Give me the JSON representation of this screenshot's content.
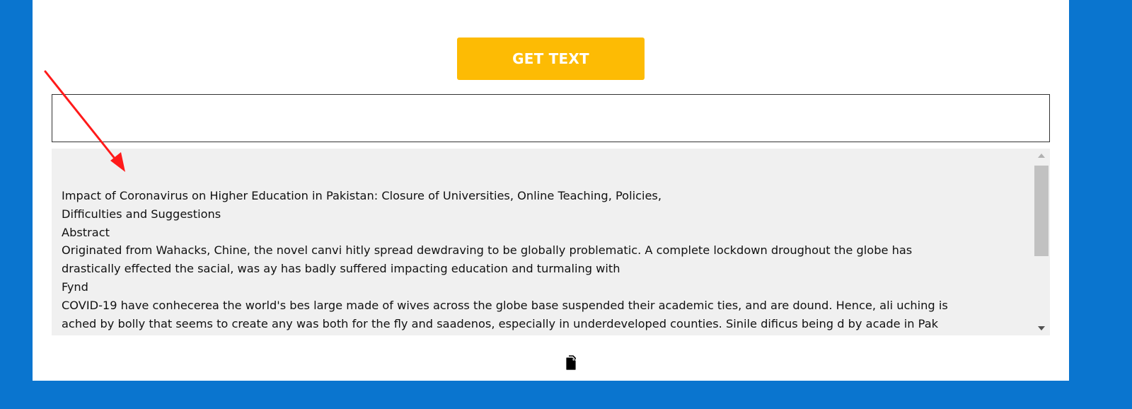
{
  "get_text_button": {
    "label": "GET TEXT"
  },
  "url_input": {
    "value": "",
    "placeholder": ""
  },
  "extracted_text": {
    "lines": [
      "Impact of Coronavirus on Higher Education in Pakistan: Closure of Universities, Online Teaching, Policies,",
      "Difficulties and Suggestions",
      "Abstract",
      "Originated from Wahacks, Chine, the novel canvi hitly spread dewdraving to be globally problematic. A complete lockdown droughout the globe has",
      "drastically effected the sacial, was ay has badly suffered impacting education and turmaling with",
      "Fynd",
      "COVID-19 have conhecerea the world's bes large made of wives across the globe base suspended their academic ties, and are dound. Hence, ali uching is",
      "ached by bolly that seems to create any was both for the fly and saadenos, especially in underdeveloped counties. Sinile dificus being d by acade in Pak"
    ]
  },
  "icons": {
    "copy": "copy-icon",
    "annotation_arrow": "red-arrow-icon"
  },
  "colors": {
    "background": "#0a75cf",
    "panel": "#ffffff",
    "button": "#fdbb04",
    "text_area": "#f0f0f0",
    "arrow": "#ff1a1a"
  }
}
